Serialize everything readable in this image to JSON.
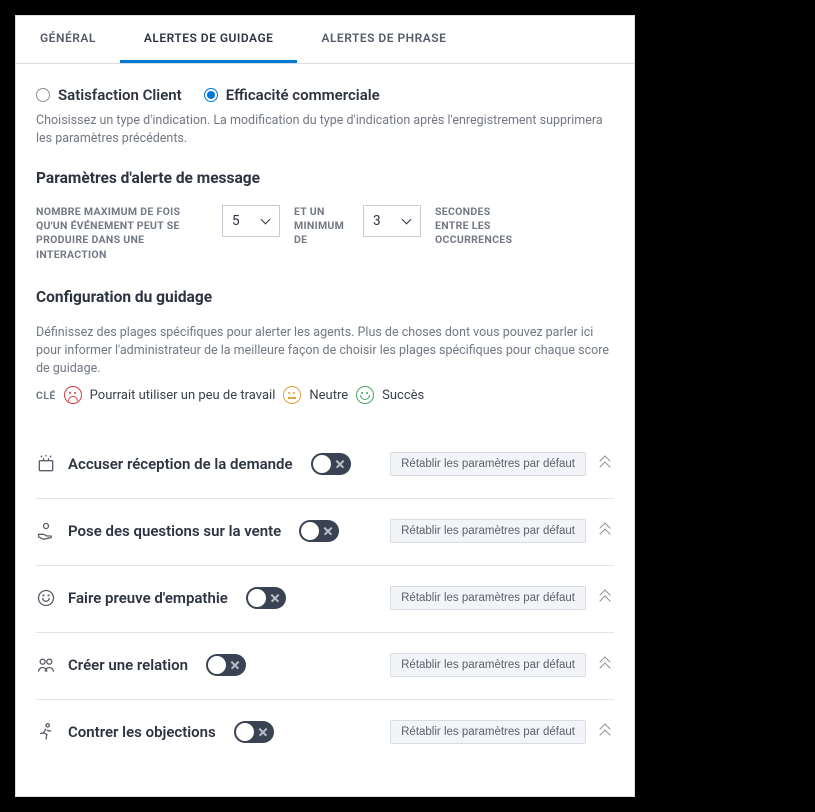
{
  "tabs": {
    "general": "GÉNÉRAL",
    "guidance": "ALERTES DE GUIDAGE",
    "phrase": "ALERTES DE PHRASE"
  },
  "type_section": {
    "option_satisfaction": "Satisfaction Client",
    "option_sales": "Efficacité commerciale",
    "help": "Choisissez un type d'indication. La modification du type d'indication après l'enregistrement supprimera les paramètres précédents."
  },
  "msg_settings": {
    "title": "Paramètres d'alerte de message",
    "max_label": "NOMBRE MAXIMUM DE FOIS QU'UN ÉVÉNEMENT PEUT SE PRODUIRE DANS UNE INTERACTION",
    "max_value": "5",
    "min_label": "ET UN MINIMUM DE",
    "min_value": "3",
    "sec_label": "SECONDES ENTRE LES OCCURRENCES"
  },
  "guidance": {
    "title": "Configuration du guidage",
    "desc": "Définissez des plages spécifiques pour alerter les agents. Plus de choses dont vous pouvez parler ici pour informer l'administrateur de la meilleure façon de choisir les plages spécifiques pour chaque score de guidage.",
    "key_label": "CLÉ",
    "key_work": "Pourrait utiliser un peu de travail",
    "key_neutral": "Neutre",
    "key_success": "Succès",
    "reset_label": "Rétablir les paramètres par défaut",
    "items": [
      {
        "label": "Accuser réception de la demande"
      },
      {
        "label": "Pose des questions sur la vente"
      },
      {
        "label": "Faire preuve d'empathie"
      },
      {
        "label": "Créer une relation"
      },
      {
        "label": "Contrer les objections"
      }
    ]
  }
}
